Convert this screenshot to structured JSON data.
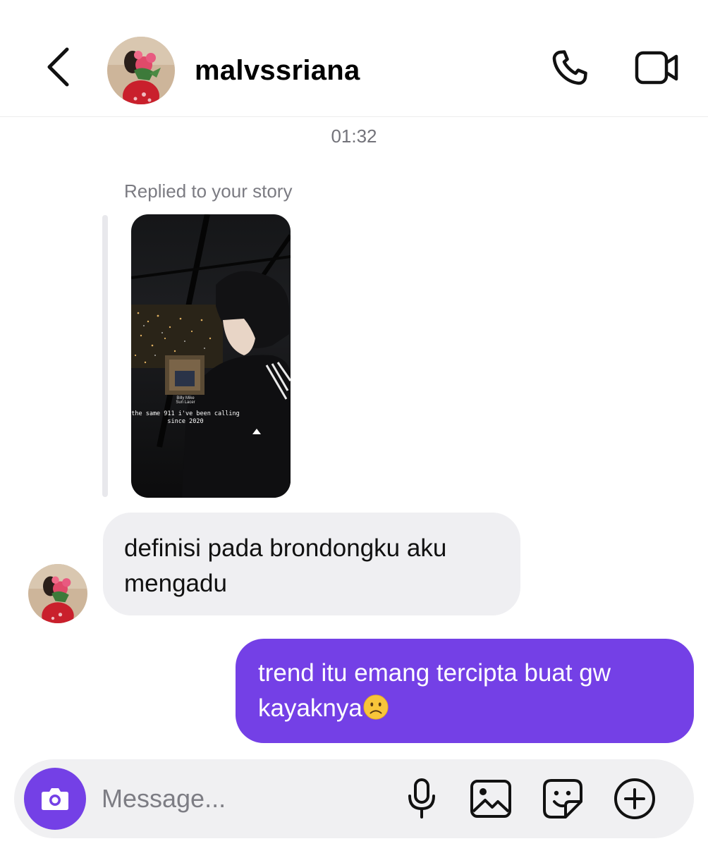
{
  "header": {
    "username": "malvssriana",
    "back_icon": "chevron-left-icon",
    "call_icon": "phone-icon",
    "video_icon": "video-camera-icon"
  },
  "conversation": {
    "timestamp": "01:32",
    "reply_label": "Replied to your story",
    "story": {
      "caption": "the same 911 i've been calling since 2020",
      "music_title": "Billy Mike",
      "music_artist": "Sun Lacer"
    },
    "incoming_message": "definisi pada brondongku aku mengadu",
    "outgoing_message": "trend itu emang tercipta buat gw kayaknya",
    "outgoing_emoji": "frowning-face-emoji"
  },
  "composer": {
    "placeholder": "Message...",
    "camera_icon": "camera-icon",
    "mic_icon": "microphone-icon",
    "gallery_icon": "image-icon",
    "sticker_icon": "sticker-icon",
    "plus_icon": "plus-circle-icon"
  },
  "colors": {
    "accent": "#7440e6",
    "incoming_bubble": "#efeff2",
    "composer_bg": "#f0f0f2",
    "secondary_text": "#73737a"
  }
}
